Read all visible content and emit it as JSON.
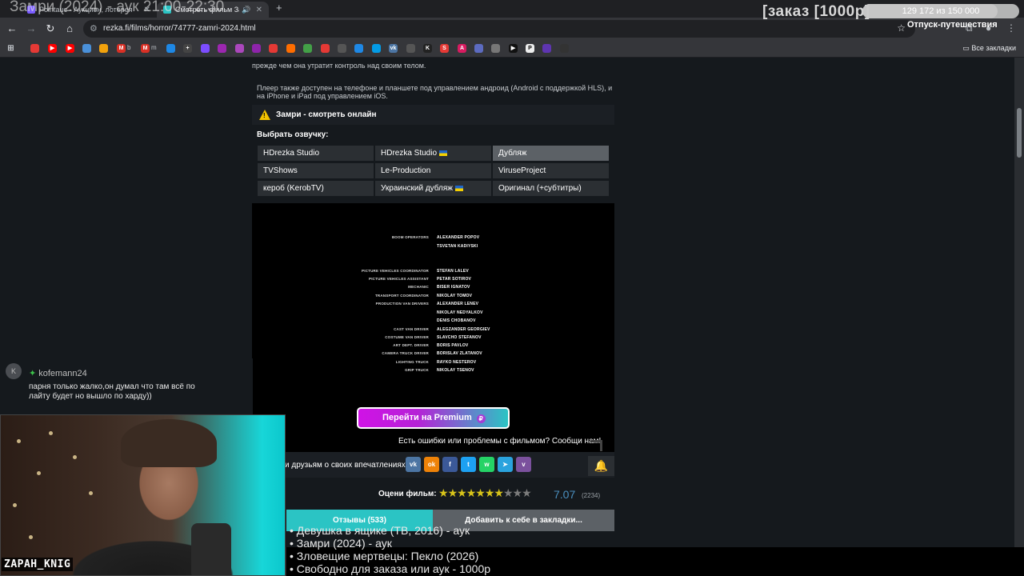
{
  "browser": {
    "tabs": [
      {
        "label": "Pointauc - Аукцион, лотерея",
        "favicon_color": "#7a5cff"
      },
      {
        "label": "Смотреть фильм Замри онлайн",
        "favicon_color": "#2bc4c4"
      }
    ],
    "url": "rezka.fi/films/horror/74777-zamri-2024.html",
    "bookmarks_letters": [
      "b",
      "m"
    ],
    "all_bookmarks": "Все закладки"
  },
  "overlay": {
    "stream_title": "Замри (2024) - аук 21:00-22:30",
    "order_label": "[заказ [1000р]",
    "progress": {
      "label": "129 172 из 150 000",
      "current": 129172,
      "total": 150000
    },
    "vacation_label": "Отпуск-путешествия"
  },
  "page": {
    "description_tail": "прежде чем она утратит контроль над своим телом.",
    "player_availability": "Плеер также доступен на телефоне и планшете под управлением андроид (Android с поддержкой HLS), и на iPhone и iPad под управлением iOS.",
    "player_title": "Замри - смотреть онлайн",
    "dub_label": "Выбрать озвучку:",
    "dubs": [
      {
        "label": "HDrezka Studio",
        "flag": false,
        "active": false
      },
      {
        "label": "HDrezka Studio",
        "flag": true,
        "active": false
      },
      {
        "label": "Дубляж",
        "flag": false,
        "active": true
      },
      {
        "label": "TVShows",
        "flag": false,
        "active": false
      },
      {
        "label": "Le-Production",
        "flag": false,
        "active": false
      },
      {
        "label": "ViruseProject",
        "flag": false,
        "active": false
      },
      {
        "label": "кероб (KerobTV)",
        "flag": false,
        "active": false
      },
      {
        "label": "Украинский дубляж",
        "flag": true,
        "active": false
      },
      {
        "label": "Оригинал (+субтитры)",
        "flag": false,
        "active": false
      }
    ],
    "credits": [
      {
        "role": "BOOM OPERATORS",
        "name": "ALEXANDER POPOV"
      },
      {
        "role": "",
        "name": "TSVETAN KADIYSKI"
      },
      {
        "role": "PICTURE VEHICLES COORDINATOR",
        "name": "STEFAN LALEV"
      },
      {
        "role": "PICTURE VEHICLES ASSISTANT",
        "name": "PETAR SOTIROV"
      },
      {
        "role": "MECHANIC",
        "name": "BISER IGNATOV"
      },
      {
        "role": "TRANSPORT COORDINATOR",
        "name": "NIKOLAY TOMOV"
      },
      {
        "role": "PRODUCTION VAN DRIVERS",
        "name": "ALEXANDER LENEV"
      },
      {
        "role": "",
        "name": "NIKOLAY NEDYALKOV"
      },
      {
        "role": "",
        "name": "DENIS CHOBANOV"
      },
      {
        "role": "CAST VAN DRIVER",
        "name": "ALEGZANDER GEORGIEV"
      },
      {
        "role": "COSTUME VAN DRIVER",
        "name": "SLAVCHO STEFANOV"
      },
      {
        "role": "ART DEPT. DRIVER",
        "name": "BORIS PAVLOV"
      },
      {
        "role": "CAMERA TRUCK DRIVER",
        "name": "BORISLAV ZLATANOV"
      },
      {
        "role": "LIGHTING TRUCK",
        "name": "RAYKO NESTEROV"
      },
      {
        "role": "GRIP TRUCK",
        "name": "NIKOLAY TSENOV"
      }
    ],
    "premium_button": "Перейти на Premium",
    "report_link": "Есть ошибки или проблемы с фильмом? Сообщи нам!",
    "share_text": "и друзьям о своих впечатлениях:",
    "social": [
      {
        "icon": "vk-icon",
        "label": "vk",
        "color": "#4c75a3"
      },
      {
        "icon": "odnoklassniki-icon",
        "label": "ok",
        "color": "#ee8208"
      },
      {
        "icon": "facebook-icon",
        "label": "f",
        "color": "#3b5998"
      },
      {
        "icon": "twitter-icon",
        "label": "t",
        "color": "#1da1f2"
      },
      {
        "icon": "whatsapp-icon",
        "label": "w",
        "color": "#25d366"
      },
      {
        "icon": "telegram-icon",
        "label": "➤",
        "color": "#2aa3de"
      },
      {
        "icon": "viber-icon",
        "label": "v",
        "color": "#7b519d"
      }
    ],
    "rating_label": "Оцени фильм:",
    "rating_value": "7.07",
    "rating_stars_filled": 7,
    "rating_stars_total": 10,
    "rating_count": "(2234)",
    "tab_reviews": "Отзывы (533)",
    "tab_bookmarks": "Добавить к себе в закладки..."
  },
  "chat": {
    "avatar_letter": "K",
    "username": "kofemann24",
    "message": "парня только жалко,он думал что там всё по лайту будет но вышло по харду))"
  },
  "streamer_name": "ZAPAH_KNIG",
  "queue": [
    "• Девушка в ящике (ТВ, 2016) - аук",
    "• Замри (2024) - аук",
    "• Зловещие мертвецы: Пекло (2026)",
    "• Свободно для заказа или аук - 1000р"
  ]
}
